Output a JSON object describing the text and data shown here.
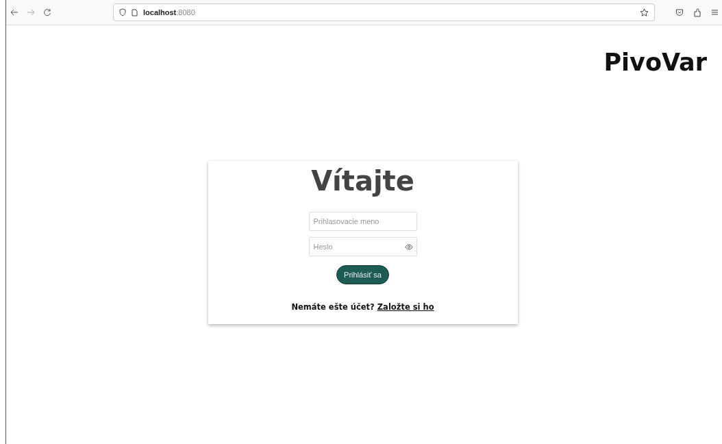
{
  "browser": {
    "url_host": "localhost",
    "url_port": ":8080"
  },
  "brand": "PivoVar",
  "login": {
    "heading": "Vítajte",
    "username": {
      "placeholder": "Prihlasovacie meno"
    },
    "password": {
      "placeholder": "Heslo"
    },
    "submit": "Prihlásiť sa",
    "signup_prompt": "Nemáte ešte účet?",
    "signup_link": "Založte si ho"
  }
}
